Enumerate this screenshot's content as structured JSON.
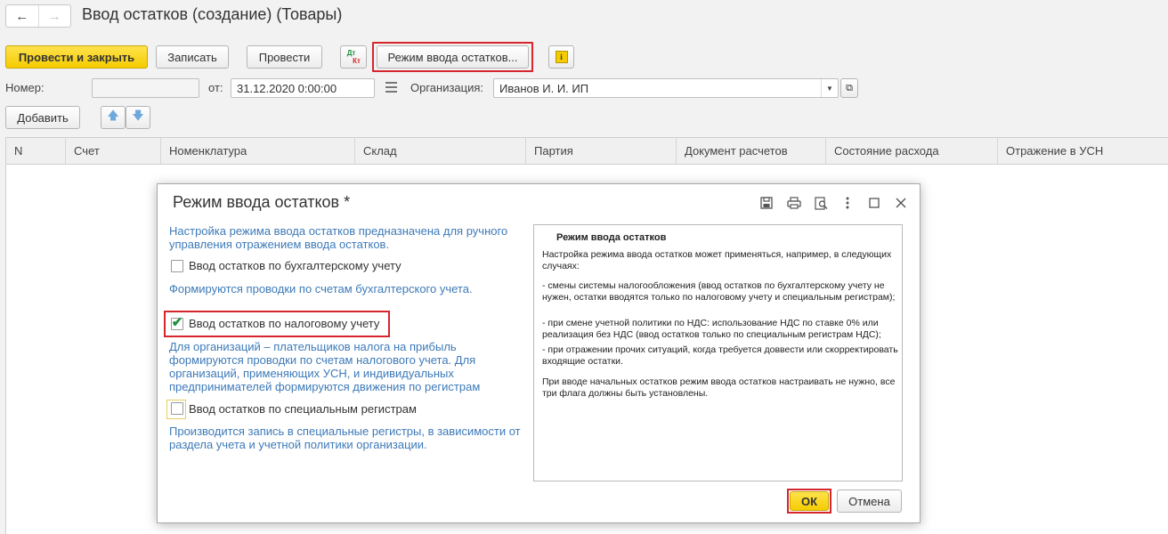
{
  "header": {
    "back_icon": "arrow-left-icon",
    "forward_icon": "arrow-right-icon",
    "title": "Ввод остатков (создание) (Товары)"
  },
  "toolbar": {
    "post_close_label": "Провести и закрыть",
    "save_label": "Записать",
    "post_label": "Провести",
    "dtkt_dt": "Дт",
    "dtkt_kt": "Кт",
    "mode_label": "Режим ввода остатков...",
    "info_icon": "info-icon"
  },
  "form": {
    "number_label": "Номер:",
    "number_value": "",
    "date_label": "от:",
    "date_value": "31.12.2020  0:00:00",
    "calendar_icon": "calendar-icon",
    "org_label": "Организация:",
    "org_value": "Иванов И. И. ИП",
    "dropdown_icon": "dropdown-arrow-icon",
    "open_icon": "open-form-icon"
  },
  "table_toolbar": {
    "add_label": "Добавить",
    "up_icon": "move-up-icon",
    "down_icon": "move-down-icon"
  },
  "table": {
    "columns": [
      "N",
      "Счет",
      "Номенклатура",
      "Склад",
      "Партия",
      "Документ расчетов",
      "Состояние расхода",
      "Отражение в УСН"
    ]
  },
  "dialog": {
    "title": "Режим ввода остатков *",
    "icons": [
      "save-icon",
      "print-icon",
      "preview-icon",
      "more-icon",
      "maximize-icon",
      "close-icon"
    ],
    "intro": "Настройка режима ввода остатков предназначена для ручного управления отражением  ввода остатков.",
    "options": [
      {
        "label": "Ввод остатков по бухгалтерскому учету",
        "checked": false,
        "note": "Формируются проводки по счетам бухгалтерского учета."
      },
      {
        "label": "Ввод остатков по налоговому учету",
        "checked": true,
        "note": "Для организаций – плательщиков налога на прибыль формируются проводки по счетам налогового учета. Для организаций, применяющих УСН, и  индивидуальных предпринимателей формируются движения по регистрам"
      },
      {
        "label": "Ввод остатков по специальным регистрам",
        "checked": false,
        "note": "Производится запись в специальные регистры, в зависимости от раздела учета и учетной политики организации."
      }
    ],
    "help": {
      "title": "Режим ввода остатков",
      "p1": "Настройка режима ввода остатков может применяться, например, в следующих случаях:",
      "p2": "- смены системы налогообложения (ввод остатков по бухгалтерскому учету не нужен, остатки вводятся только по налоговому учету и специальным регистрам);",
      "p3": "- при смене учетной политики по НДС: использование НДС по ставке 0% или реализация без НДС (ввод остатков только по специальным регистрам НДС);",
      "p4": "- при отражении прочих ситуаций, когда требуется доввести или скорректировать входящие остатки.",
      "p5": "При вводе начальных остатков режим ввода остатков настраивать не нужно, все три флага должны быть установлены."
    },
    "ok_label": "ОК",
    "cancel_label": "Отмена"
  },
  "colors": {
    "accent_yellow": "#f5cc00",
    "highlight_red": "#d6252c",
    "link_blue": "#3d7ab8",
    "check_green": "#1e8f3e"
  }
}
